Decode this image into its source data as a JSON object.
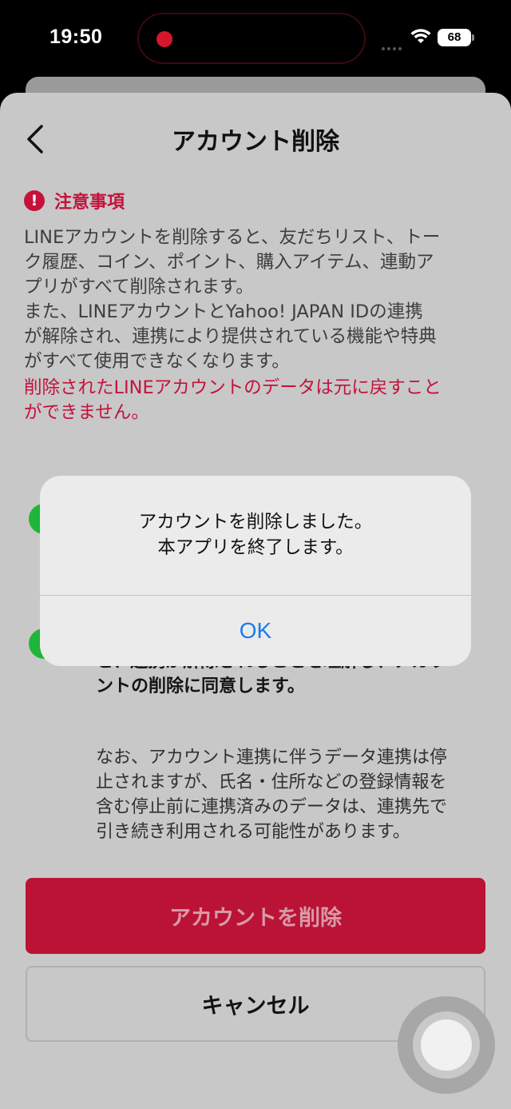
{
  "status_bar": {
    "time": "19:50",
    "battery": "68"
  },
  "nav": {
    "title": "アカウント削除"
  },
  "notice": {
    "title": "注意事項",
    "body_lines": [
      "LINEアカウントを削除すると、友だちリスト、トー",
      "ク履歴、コイン、ポイント、購入アイテム、連動ア",
      "プリがすべて削除されます。",
      "また、LINEアカウントとYahoo! JAPAN IDの連携",
      "が解除され、連携により提供されている機能や特典",
      "がすべて使用できなくなります。"
    ],
    "warning_lines": [
      "削除されたLINEアカウントのデータは元に戻すこと",
      "ができません。"
    ]
  },
  "agreement": {
    "strong_lines": [
      "と、連携が解除されることを理解し、アカウ",
      "ントの削除に同意します。"
    ],
    "note_lines": [
      "なお、アカウント連携に伴うデータ連携は停",
      "止されますが、氏名・住所などの登録情報を",
      "含む停止前に連携済みのデータは、連携先で",
      "引き続き利用される可能性があります。"
    ]
  },
  "buttons": {
    "delete_label": "アカウントを削除",
    "cancel_label": "キャンセル"
  },
  "alert": {
    "message_lines": [
      "アカウントを削除しました。",
      "本アプリを終了します。"
    ],
    "ok_label": "OK"
  },
  "colors": {
    "accent_red": "#c4123b",
    "ios_blue": "#1a7cf0",
    "check_green": "#1fb53a"
  },
  "icons": [
    "chevron-left-icon",
    "exclamation-icon",
    "check-icon",
    "wifi-icon",
    "battery-icon"
  ]
}
